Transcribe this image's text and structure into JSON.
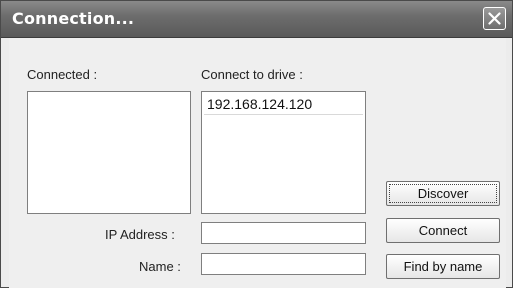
{
  "dialog": {
    "title": "Connection...",
    "close_icon": "close-icon"
  },
  "labels": {
    "connected": "Connected :",
    "connect_to_drive": "Connect to drive :",
    "ip_address": "IP Address :",
    "name": "Name :"
  },
  "connected_list": {
    "items": []
  },
  "drive_list": {
    "items": [
      "192.168.124.120"
    ]
  },
  "inputs": {
    "ip_address_value": "",
    "name_value": ""
  },
  "buttons": {
    "discover": "Discover",
    "connect": "Connect",
    "find_by_name": "Find by name"
  }
}
